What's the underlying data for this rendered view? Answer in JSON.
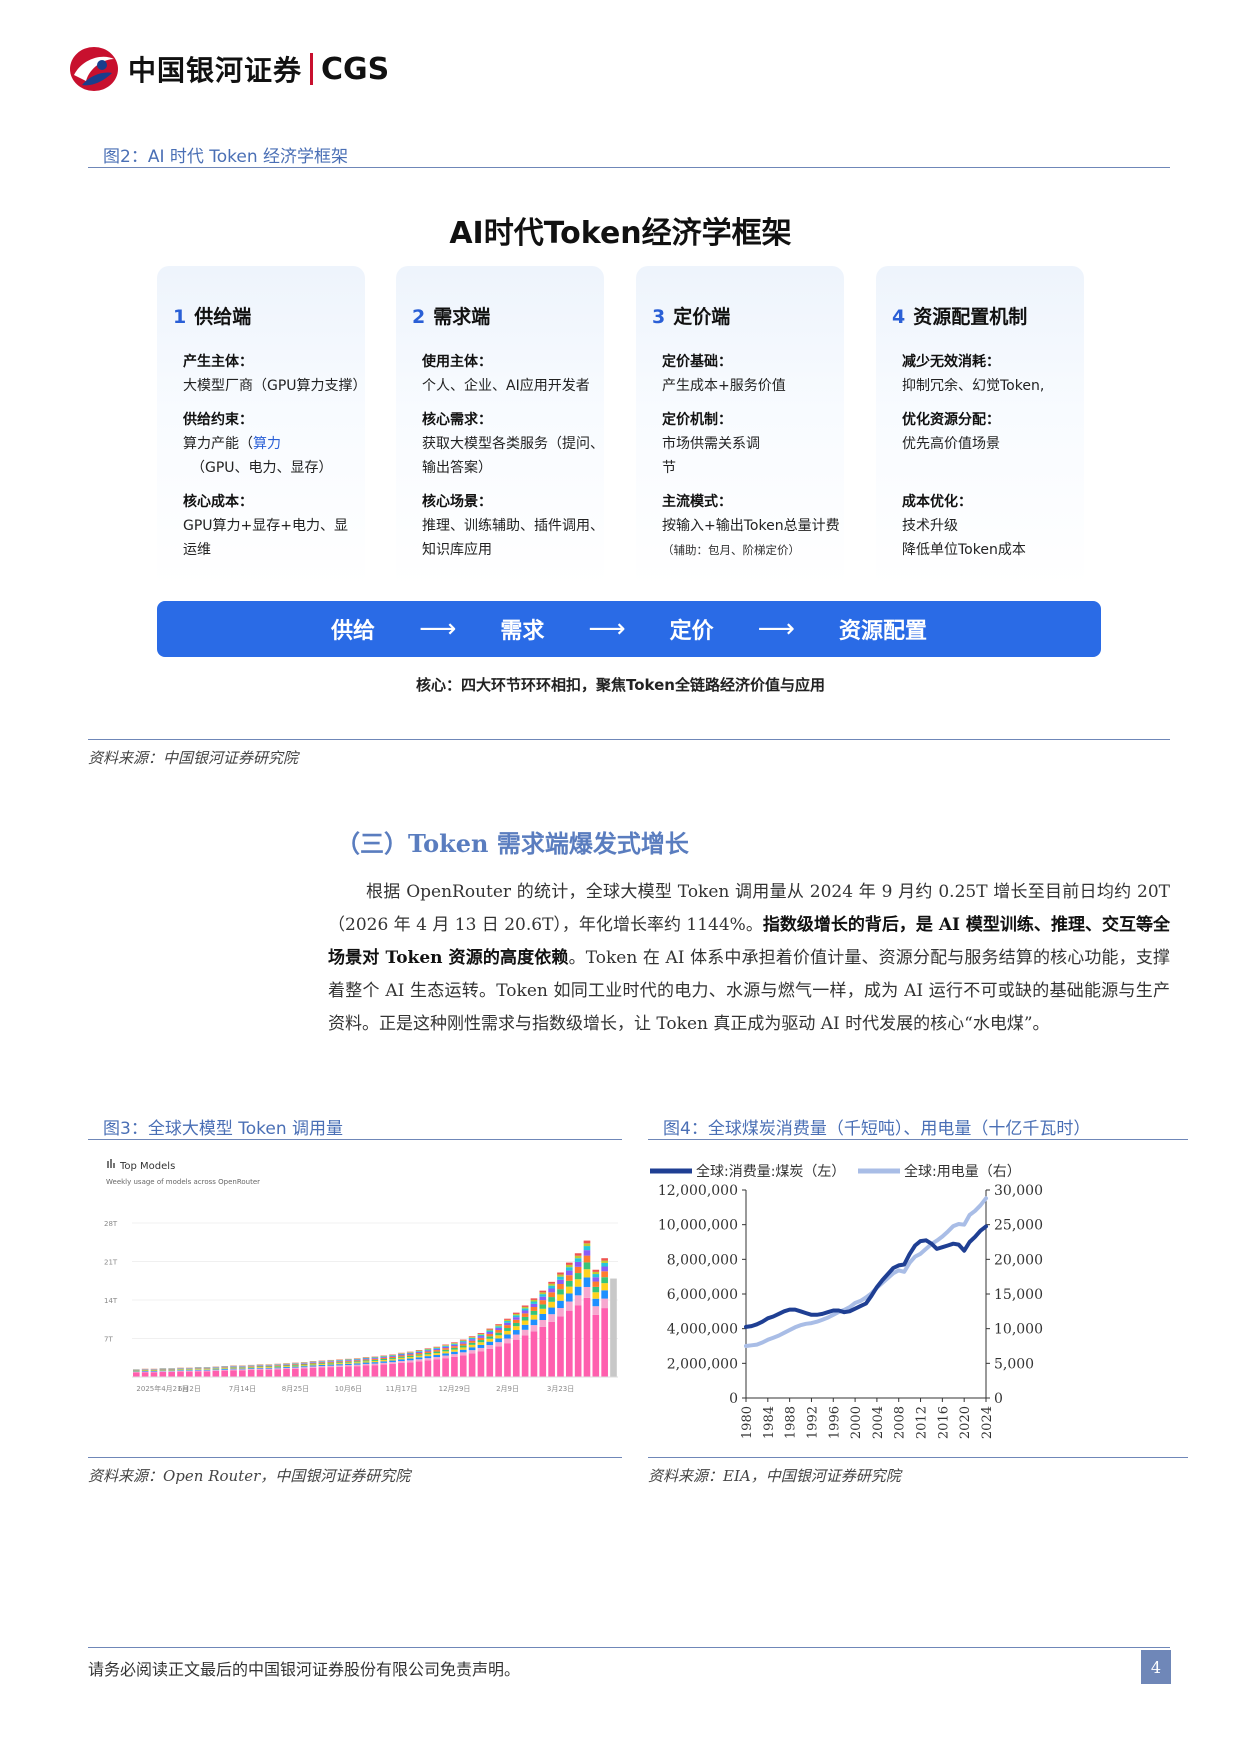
{
  "header": {
    "brand": "中国银河证券",
    "brand_en": "CGS"
  },
  "figure2": {
    "caption": "图2：AI 时代 Token 经济学框架",
    "title": "AI时代Token经济学框架",
    "cards": [
      {
        "num": "1",
        "title": "供给端",
        "sections": [
          {
            "label": "产生主体：",
            "lines": [
              "大模型厂商（GPU算力支撑）"
            ]
          },
          {
            "label": "供给约束：",
            "lines": [
              "算力产能（",
              "算力",
              "（GPU、电力、显存）"
            ]
          },
          {
            "label": "核心成本：",
            "lines": [
              "GPU算力+显存+电力、显",
              "运维"
            ]
          }
        ]
      },
      {
        "num": "2",
        "title": "需求端",
        "sections": [
          {
            "label": "使用主体：",
            "lines": [
              "个人、企业、AI应用开发者"
            ]
          },
          {
            "label": "核心需求：",
            "lines": [
              "获取大模型各类服务（提问、",
              "输出答案）"
            ]
          },
          {
            "label": "核心场景：",
            "lines": [
              "推理、训练辅助、插件调用、",
              "知识库应用"
            ]
          }
        ]
      },
      {
        "num": "3",
        "title": "定价端",
        "sections": [
          {
            "label": "定价基础：",
            "lines": [
              "产生成本+服务价值"
            ]
          },
          {
            "label": "定价机制：",
            "lines": [
              "市场供需关系调",
              "节"
            ]
          },
          {
            "label": "主流模式：",
            "lines": [
              "按输入+输出Token总量计费",
              "（辅助：包月、阶梯定价）"
            ]
          }
        ]
      },
      {
        "num": "4",
        "title": "资源配置机制",
        "sections": [
          {
            "label": "减少无效消耗：",
            "lines": [
              "抑制冗余、幻觉Token,"
            ]
          },
          {
            "label": "优化资源分配：",
            "lines": [
              "优先高价值场景"
            ]
          },
          {
            "label": "成本优化：",
            "lines": [
              "技术升级",
              "降低单位Token成本"
            ]
          }
        ]
      }
    ],
    "flow": [
      "供给",
      "需求",
      "定价",
      "资源配置"
    ],
    "flow_arrow": "⟶",
    "core": "核心：四大环节环环相扣，聚焦Token全链路经济价值与应用",
    "source": "资料来源：中国银河证券研究院"
  },
  "section": {
    "title": "（三）Token 需求端爆发式增长",
    "para_1": "根据 OpenRouter 的统计，全球大模型 Token 调用量从 2024 年 9 月约 0.25T 增长至目前日均约 20T（2026 年 4 月 13 日 20.6T），年化增长率约 1144%。",
    "para_bold": "指数级增长的背后，是 AI 模型训练、推理、交互等全场景对 Token 资源的高度依赖",
    "para_2": "。Token 在 AI 体系中承担着价值计量、资源分配与服务结算的核心功能，支撑着整个 AI 生态运转。Token 如同工业时代的电力、水源与燃气一样，成为 AI 运行不可或缺的基础能源与生产资料。正是这种刚性需求与指数级增长，让 Token 真正成为驱动 AI 时代发展的核心“水电煤”。"
  },
  "figure3": {
    "caption": "图3：全球大模型 Token 调用量",
    "source": "资料来源：Open Router，中国银河证券研究院",
    "chart_data": {
      "type": "bar",
      "title": "Top Models",
      "subtitle": "Weekly usage of models across OpenRouter",
      "y_ticks": [
        "28T",
        "21T",
        "14T",
        "7T"
      ],
      "ylim": [
        0,
        28
      ],
      "x_ticks": [
        "2025年4月21日",
        "6月2日",
        "7月14日",
        "8月25日",
        "10月6日",
        "11月17日",
        "12月29日",
        "2月9日",
        "3月23日"
      ],
      "values": [
        1.4,
        1.5,
        1.5,
        1.6,
        1.6,
        1.7,
        1.7,
        1.8,
        1.8,
        1.9,
        2.0,
        2.1,
        2.1,
        2.2,
        2.3,
        2.3,
        2.4,
        2.5,
        2.6,
        2.7,
        2.9,
        3.0,
        3.1,
        3.2,
        3.3,
        3.4,
        3.6,
        3.7,
        3.9,
        4.1,
        4.4,
        4.6,
        4.9,
        5.2,
        5.5,
        5.9,
        6.3,
        6.8,
        7.4,
        8.0,
        8.8,
        9.6,
        10.6,
        11.7,
        13.0,
        14.3,
        15.7,
        17.3,
        19.0,
        20.8,
        22.5,
        24.8,
        19.5,
        21.6,
        17.9
      ]
    }
  },
  "figure4": {
    "caption": "图4：全球煤炭消费量（千短吨）、用电量（十亿千瓦时）",
    "source": "资料来源：EIA，中国银河证券研究院",
    "chart_data": {
      "type": "line",
      "x": [
        1980,
        1981,
        1982,
        1983,
        1984,
        1985,
        1986,
        1987,
        1988,
        1989,
        1990,
        1991,
        1992,
        1993,
        1994,
        1995,
        1996,
        1997,
        1998,
        1999,
        2000,
        2001,
        2002,
        2003,
        2004,
        2005,
        2006,
        2007,
        2008,
        2009,
        2010,
        2011,
        2012,
        2013,
        2014,
        2015,
        2016,
        2017,
        2018,
        2019,
        2020,
        2021,
        2022,
        2023,
        2024
      ],
      "x_ticks": [
        "1980",
        "1984",
        "1988",
        "1992",
        "1996",
        "2000",
        "2004",
        "2008",
        "2012",
        "2016",
        "2020",
        "2024"
      ],
      "left_ticks": [
        "12,000,000",
        "10,000,000",
        "8,000,000",
        "6,000,000",
        "4,000,000",
        "2,000,000",
        "0"
      ],
      "right_ticks": [
        "30,000",
        "25,000",
        "20,000",
        "15,000",
        "10,000",
        "5,000",
        "0"
      ],
      "ylim_left": [
        0,
        12000000
      ],
      "ylim_right": [
        0,
        30000
      ],
      "series": [
        {
          "name": "全球:消费量:煤炭（左）",
          "axis": "left",
          "color": "#1f3f93",
          "values": [
            4100000,
            4150000,
            4250000,
            4400000,
            4600000,
            4700000,
            4850000,
            5000000,
            5100000,
            5100000,
            5000000,
            4900000,
            4800000,
            4800000,
            4850000,
            4950000,
            5050000,
            5050000,
            4950000,
            5000000,
            5150000,
            5300000,
            5450000,
            5900000,
            6400000,
            6800000,
            7150000,
            7500000,
            7650000,
            7700000,
            8300000,
            8800000,
            9050000,
            9100000,
            8900000,
            8600000,
            8700000,
            8800000,
            8900000,
            8850000,
            8500000,
            9000000,
            9300000,
            9650000,
            9900000
          ]
        },
        {
          "name": "全球:用电量（右）",
          "axis": "right",
          "color": "#a9bde6",
          "values": [
            7500,
            7600,
            7700,
            8000,
            8400,
            8700,
            9000,
            9400,
            9800,
            10200,
            10500,
            10700,
            10800,
            11000,
            11300,
            11600,
            12000,
            12400,
            12700,
            13100,
            13700,
            14000,
            14500,
            15100,
            15900,
            16600,
            17300,
            18000,
            18400,
            18200,
            19500,
            20400,
            20800,
            21500,
            22200,
            22700,
            23300,
            24000,
            24800,
            25100,
            25000,
            26400,
            27000,
            27800,
            28800
          ]
        }
      ]
    }
  },
  "footer": {
    "disclaimer": "请务必阅读正文最后的中国银河证券股份有限公司免责声明。",
    "page": "4"
  }
}
